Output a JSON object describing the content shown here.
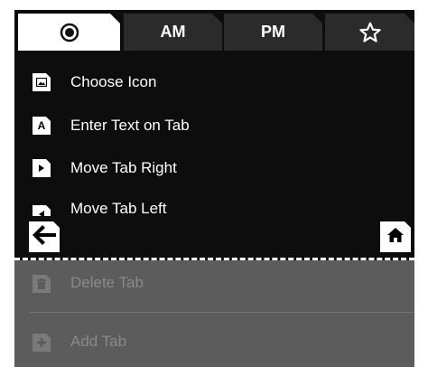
{
  "tabs": [
    {
      "label": "",
      "icon": "radio-circle-icon",
      "active": true
    },
    {
      "label": "AM",
      "active": false
    },
    {
      "label": "PM",
      "active": false
    },
    {
      "label": "",
      "icon": "star-outline-icon",
      "active": false
    }
  ],
  "menu": {
    "items": [
      {
        "label": "Choose Icon",
        "icon": "image-icon"
      },
      {
        "label": "Enter Text on Tab",
        "icon": "letter-a-icon",
        "glyph": "A"
      },
      {
        "label": "Move Tab Right",
        "icon": "chevron-right-icon"
      },
      {
        "label": "Move Tab Left",
        "icon": "chevron-left-icon"
      }
    ],
    "disabled_items": [
      {
        "label": "Delete Tab",
        "icon": "trash-icon"
      },
      {
        "label": "Add Tab",
        "icon": "plus-icon"
      }
    ]
  },
  "nav": {
    "back_icon": "arrow-left-icon",
    "home_icon": "home-icon"
  },
  "colors": {
    "background": "#0d0d0d",
    "active_tab": "#ffffff",
    "inactive_tab": "#2b2b2b",
    "disabled_area": "#5c5c5c"
  }
}
